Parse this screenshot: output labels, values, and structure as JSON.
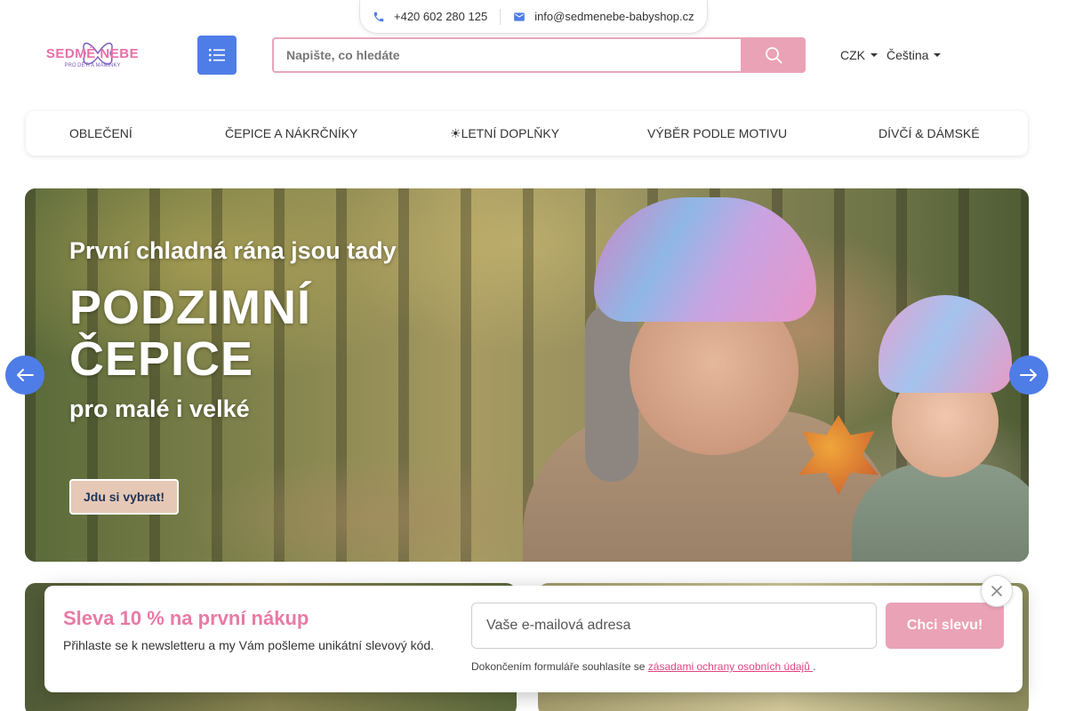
{
  "header": {
    "phone": "+420 602 280 125",
    "email": "info@sedmenebe-babyshop.cz",
    "logo_text": "SEDMÉ NEBE",
    "logo_tagline": "PRO DĚTI A MAMINKY",
    "search_placeholder": "Napište, co hledáte",
    "currency": "CZK",
    "language": "Čeština"
  },
  "nav": {
    "categories": [
      {
        "icon": "",
        "label": "OBLEČENÍ"
      },
      {
        "icon": "",
        "label": "ČEPICE A NÁKRČNÍKY"
      },
      {
        "icon": "☀",
        "label": "LETNÍ DOPLŇKY"
      },
      {
        "icon": "",
        "label": "VÝBĚR PODLE MOTIVU"
      },
      {
        "icon": "",
        "label": "DÍVČÍ & DÁMSKÉ"
      }
    ],
    "more_icon": ""
  },
  "hero": {
    "subtitle": "První chladná rána jsou tady ",
    "title_line1": "PODZIMNÍ",
    "title_line2": "ČEPICE",
    "tagline": "pro malé i velké",
    "cta": "Jdu si vybrat!"
  },
  "newsletter": {
    "title": "Sleva 10 % na první nákup ",
    "text": "Přihlaste se k newsletteru a my Vám pošleme unikátní slevový kód.",
    "email_placeholder": "Vaše e-mailová adresa",
    "button": "Chci slevu!",
    "consent_prefix": "Dokončením formuláře souhlasíte se ",
    "consent_link": "zásadami ochrany osobních údajů ",
    "consent_suffix": "."
  },
  "colors": {
    "accent_blue": "#4f7de8",
    "accent_pink": "#eaa2b6",
    "title_pink": "#e87aa5"
  }
}
